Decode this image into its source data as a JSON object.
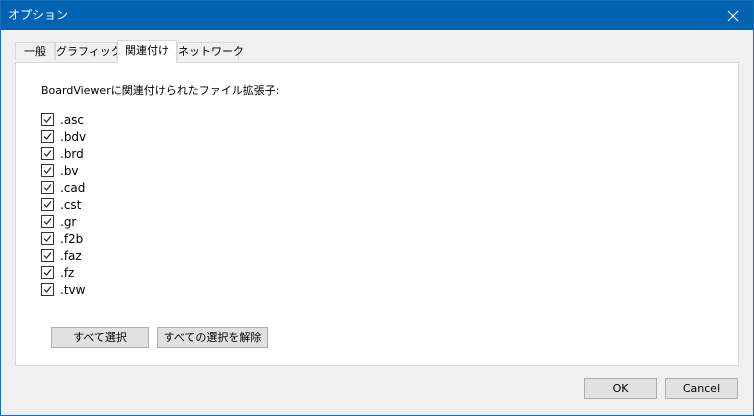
{
  "window": {
    "title": "オプション",
    "close_icon": "close-icon"
  },
  "tabs": [
    {
      "label": "一般",
      "active": false
    },
    {
      "label": "グラフィック",
      "active": false
    },
    {
      "label": "関連付け",
      "active": true
    },
    {
      "label": "ネットワーク",
      "active": false
    }
  ],
  "association": {
    "label": "BoardViewerに関連付けられたファイル拡張子:",
    "extensions": [
      {
        "label": ".asc",
        "checked": true
      },
      {
        "label": ".bdv",
        "checked": true
      },
      {
        "label": ".brd",
        "checked": true
      },
      {
        "label": ".bv",
        "checked": true
      },
      {
        "label": ".cad",
        "checked": true
      },
      {
        "label": ".cst",
        "checked": true
      },
      {
        "label": ".gr",
        "checked": true
      },
      {
        "label": ".f2b",
        "checked": true
      },
      {
        "label": ".faz",
        "checked": true
      },
      {
        "label": ".fz",
        "checked": true
      },
      {
        "label": ".tvw",
        "checked": true
      }
    ],
    "select_all_label": "すべて選択",
    "deselect_all_label": "すべての選択を解除"
  },
  "footer": {
    "ok_label": "OK",
    "cancel_label": "Cancel"
  },
  "colors": {
    "titlebar": "#0063b1",
    "dialog_bg": "#f0f0f0",
    "panel_bg": "#ffffff",
    "button_bg": "#e1e1e1"
  }
}
